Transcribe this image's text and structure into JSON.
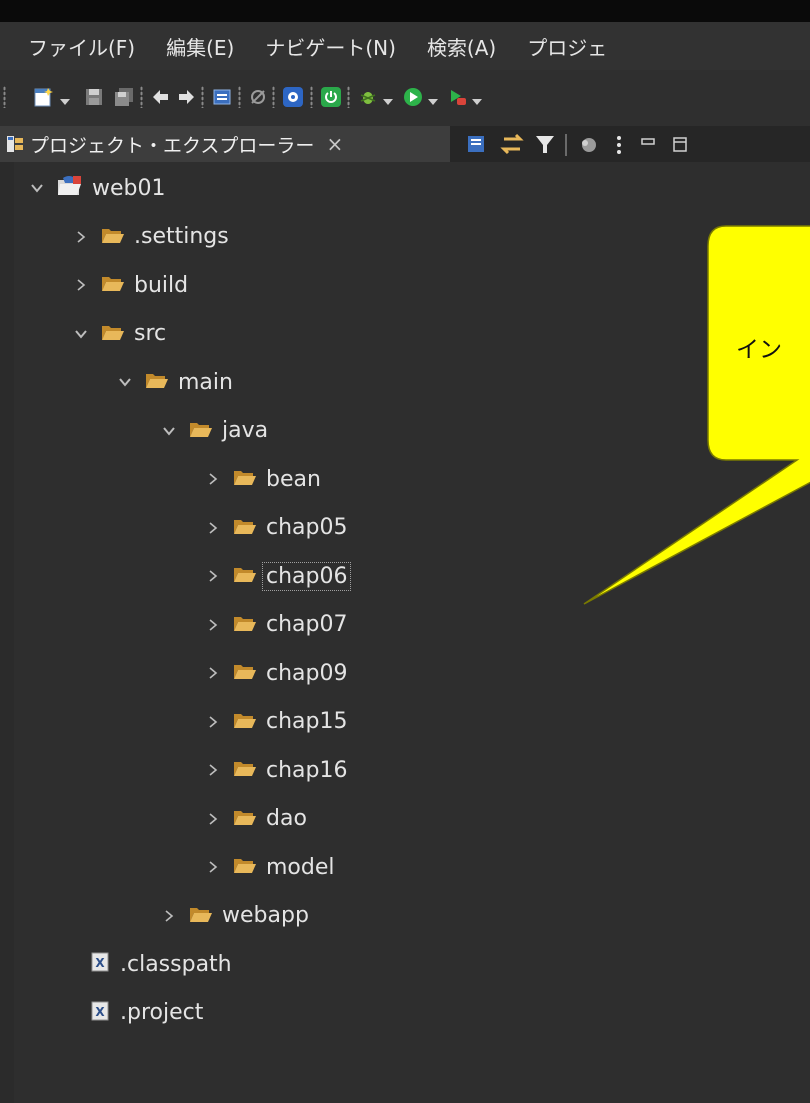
{
  "menubar": {
    "items": [
      "ファイル(F)",
      "編集(E)",
      "ナビゲート(N)",
      "検索(A)",
      "プロジェ"
    ]
  },
  "view": {
    "tab_title": "プロジェクト・エクスプローラー",
    "close_glyph": "×"
  },
  "tree": [
    {
      "label": "web01",
      "depth": 0,
      "expanded": true,
      "icon": "project-icon"
    },
    {
      "label": ".settings",
      "depth": 1,
      "expanded": false,
      "icon": "folder-icon"
    },
    {
      "label": "build",
      "depth": 1,
      "expanded": false,
      "icon": "folder-icon"
    },
    {
      "label": "src",
      "depth": 1,
      "expanded": true,
      "icon": "folder-icon"
    },
    {
      "label": "main",
      "depth": 2,
      "expanded": true,
      "icon": "folder-icon"
    },
    {
      "label": "java",
      "depth": 3,
      "expanded": true,
      "icon": "folder-icon"
    },
    {
      "label": "bean",
      "depth": 4,
      "expanded": false,
      "icon": "folder-icon"
    },
    {
      "label": "chap05",
      "depth": 4,
      "expanded": false,
      "icon": "folder-icon"
    },
    {
      "label": "chap06",
      "depth": 4,
      "expanded": false,
      "icon": "folder-icon",
      "selected": true
    },
    {
      "label": "chap07",
      "depth": 4,
      "expanded": false,
      "icon": "folder-icon"
    },
    {
      "label": "chap09",
      "depth": 4,
      "expanded": false,
      "icon": "folder-icon"
    },
    {
      "label": "chap15",
      "depth": 4,
      "expanded": false,
      "icon": "folder-icon"
    },
    {
      "label": "chap16",
      "depth": 4,
      "expanded": false,
      "icon": "folder-icon"
    },
    {
      "label": "dao",
      "depth": 4,
      "expanded": false,
      "icon": "folder-icon"
    },
    {
      "label": "model",
      "depth": 4,
      "expanded": false,
      "icon": "folder-icon"
    },
    {
      "label": "webapp",
      "depth": 3,
      "expanded": false,
      "icon": "folder-icon"
    },
    {
      "label": ".classpath",
      "depth": 1,
      "expanded": null,
      "icon": "xml-file-icon"
    },
    {
      "label": ".project",
      "depth": 1,
      "expanded": null,
      "icon": "xml-file-icon"
    }
  ],
  "callout": {
    "text": "イン",
    "fill": "#ffff00",
    "stroke": "#7a7a00"
  },
  "colors": {
    "folder": "#e8b85a",
    "background": "#2e2e2e",
    "text": "#e4e4e4"
  }
}
